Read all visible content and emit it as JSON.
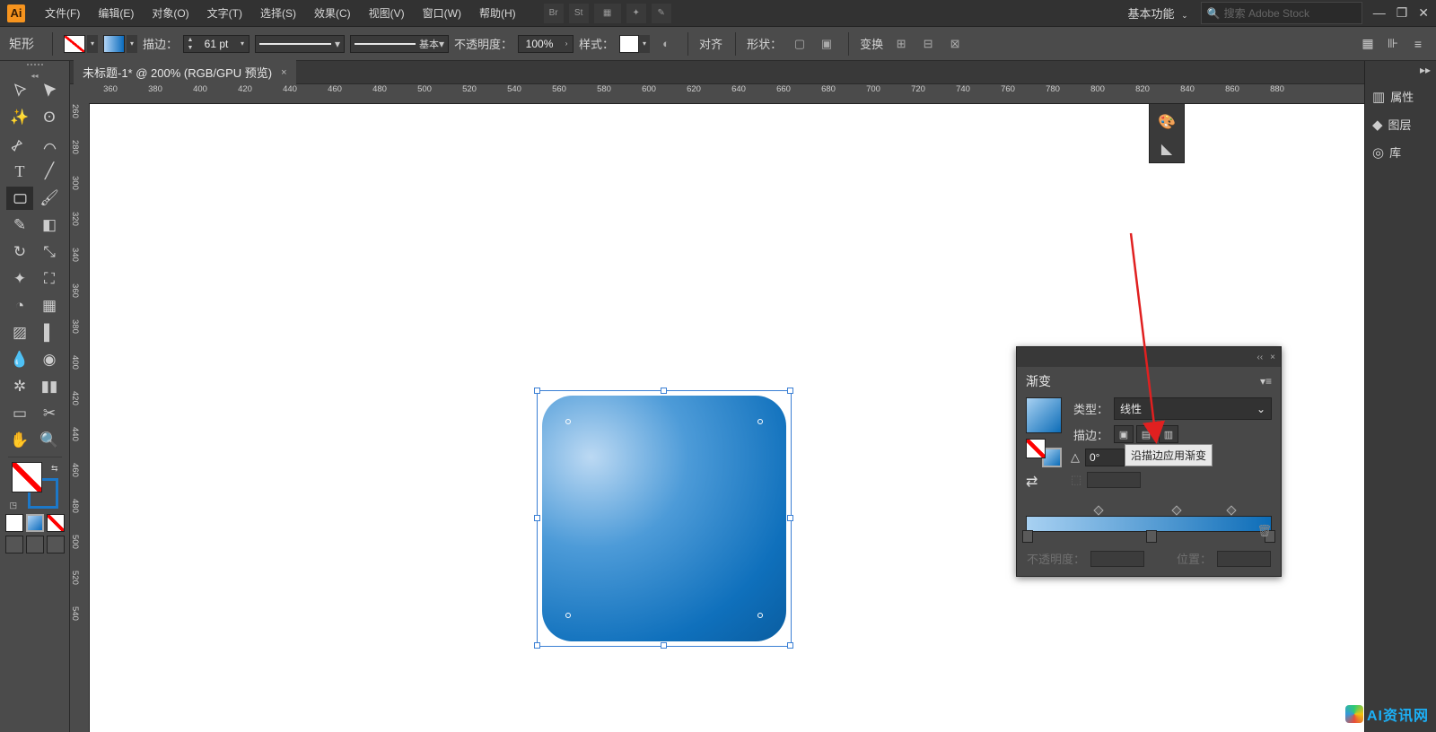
{
  "app_logo": "Ai",
  "menu": {
    "items": [
      "文件(F)",
      "编辑(E)",
      "对象(O)",
      "文字(T)",
      "选择(S)",
      "效果(C)",
      "视图(V)",
      "窗口(W)",
      "帮助(H)"
    ],
    "badge_br": "Br",
    "badge_st": "St",
    "workspace_label": "基本功能",
    "search_placeholder": "搜索 Adobe Stock"
  },
  "control": {
    "shape_label": "矩形",
    "stroke_label": "描边：",
    "stroke_value": "61 pt",
    "stroke_style_label": "基本",
    "opacity_label": "不透明度：",
    "opacity_value": "100%",
    "style_label": "样式：",
    "align_label": "对齐",
    "shape_text_label": "形状：",
    "transform_label": "变换"
  },
  "document": {
    "tab_title": "未标题-1* @ 200% (RGB/GPU 预览)",
    "ruler_h": [
      "360",
      "380",
      "400",
      "420",
      "440",
      "460",
      "480",
      "500",
      "520",
      "540",
      "560",
      "580",
      "600",
      "620",
      "640",
      "660",
      "680",
      "700",
      "720",
      "740",
      "760",
      "780",
      "800",
      "820",
      "840",
      "860",
      "880"
    ],
    "ruler_v": [
      "260",
      "280",
      "300",
      "320",
      "340",
      "360",
      "380",
      "400",
      "420",
      "440",
      "460",
      "480",
      "500",
      "520",
      "540"
    ]
  },
  "mini_panel": {
    "close": "×",
    "collapse": "‹‹"
  },
  "right_dock": {
    "items": [
      {
        "icon": "▥",
        "label": "属性"
      },
      {
        "icon": "◆",
        "label": "图层"
      },
      {
        "icon": "◎",
        "label": "库"
      }
    ]
  },
  "gradient_panel": {
    "title": "渐变",
    "type_label": "类型：",
    "type_value": "线性",
    "stroke_label": "描边：",
    "angle_symbol": "△",
    "angle_value": "0°",
    "tooltip": "沿描边应用渐变",
    "aspect_icon": "⬚",
    "opacity_label": "不透明度：",
    "position_label": "位置："
  },
  "watermark_text": "AI资讯网"
}
